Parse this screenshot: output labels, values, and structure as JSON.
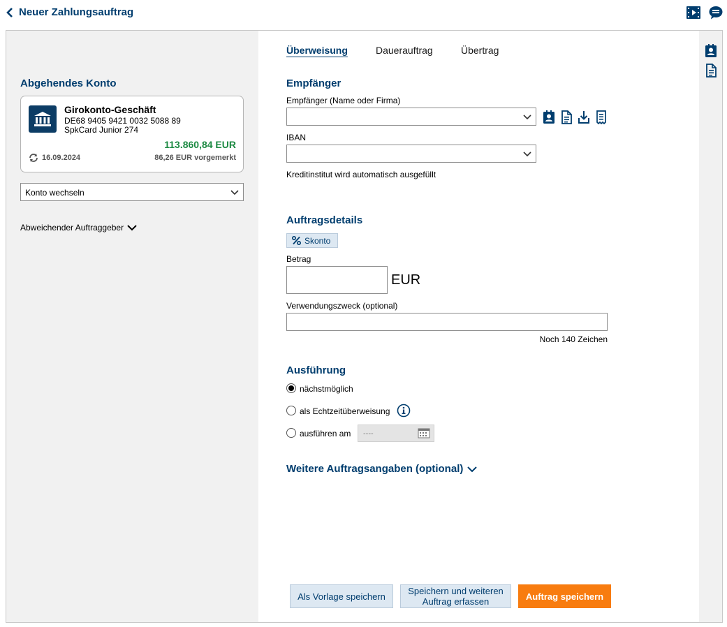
{
  "header": {
    "title": "Neuer Zahlungsauftrag",
    "icons": [
      "video-tutorial-icon",
      "chat-icon"
    ]
  },
  "left": {
    "section_title": "Abgehendes Konto",
    "account": {
      "name": "Girokonto-Geschäft",
      "iban": "DE68 9405 9421 0032 5088 89",
      "card": "SpkCard Junior 274",
      "balance": "113.860,84 EUR",
      "balance_color": "#1d8a43",
      "date": "16.09.2024",
      "reserved": "86,26 EUR vorgemerkt"
    },
    "switch_account": "Konto wechseln",
    "alt_payer": "Abweichender Auftraggeber"
  },
  "tabs": [
    {
      "label": "Überweisung",
      "active": true
    },
    {
      "label": "Dauerauftrag",
      "active": false
    },
    {
      "label": "Übertrag",
      "active": false
    }
  ],
  "recipient": {
    "section_title": "Empfänger",
    "name_label": "Empfänger (Name oder Firma)",
    "name_value": "",
    "iban_label": "IBAN",
    "iban_value": "",
    "bank_hint": "Kreditinstitut wird automatisch ausgefüllt"
  },
  "details": {
    "section_title": "Auftragsdetails",
    "skonto": "Skonto",
    "amount_label": "Betrag",
    "amount_value": "",
    "currency": "EUR",
    "purpose_label": "Verwendungszweck (optional)",
    "purpose_value": "",
    "chars_left": "Noch 140 Zeichen"
  },
  "execution": {
    "section_title": "Ausführung",
    "options": [
      {
        "label": "nächstmöglich",
        "checked": true
      },
      {
        "label": "als Echtzeitüberweisung",
        "checked": false
      },
      {
        "label": "ausführen am",
        "checked": false
      }
    ],
    "date_placeholder": "----"
  },
  "more": {
    "label": "Weitere Auftragsangaben (optional)"
  },
  "buttons": {
    "save_template": "Als Vorlage speichern",
    "save_and_more_line1": "Speichern und weiteren",
    "save_and_more_line2": "Auftrag erfassen",
    "save_order": "Auftrag speichern"
  },
  "colors": {
    "brand_blue": "#003d6e",
    "accent_orange": "#f87c0f"
  }
}
